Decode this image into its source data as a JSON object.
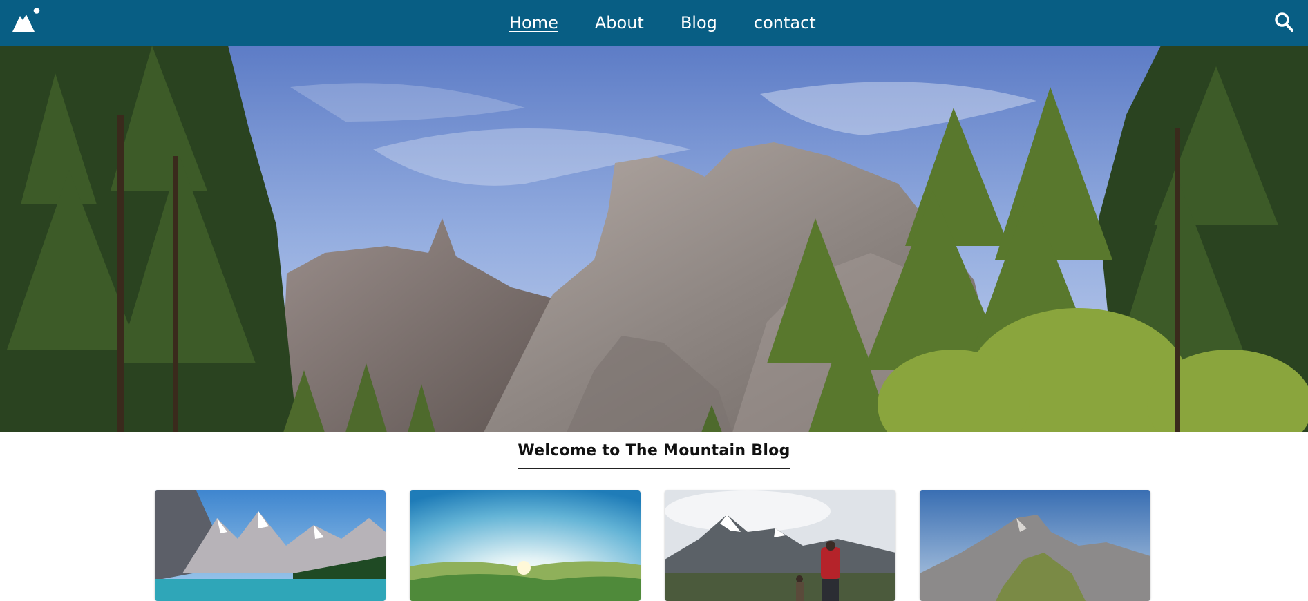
{
  "navbar": {
    "background": "#085e84",
    "logo_icon": "mountain-sun-icon",
    "links": [
      {
        "label": "Home",
        "active": true
      },
      {
        "label": "About",
        "active": false
      },
      {
        "label": "Blog",
        "active": false
      },
      {
        "label": "contact",
        "active": false
      }
    ],
    "search_icon": "search-icon"
  },
  "hero": {
    "image": "mountain cliffs with pine trees under blue sky"
  },
  "welcome": {
    "title": "Welcome to The Mountain Blog"
  },
  "cards": [
    {
      "image": "turquoise lake with snowy mountain range"
    },
    {
      "image": "sun rising over green hills"
    },
    {
      "image": "hiker with red backpack facing snowy peaks"
    },
    {
      "image": "rocky mountain summit under blue sky"
    }
  ]
}
